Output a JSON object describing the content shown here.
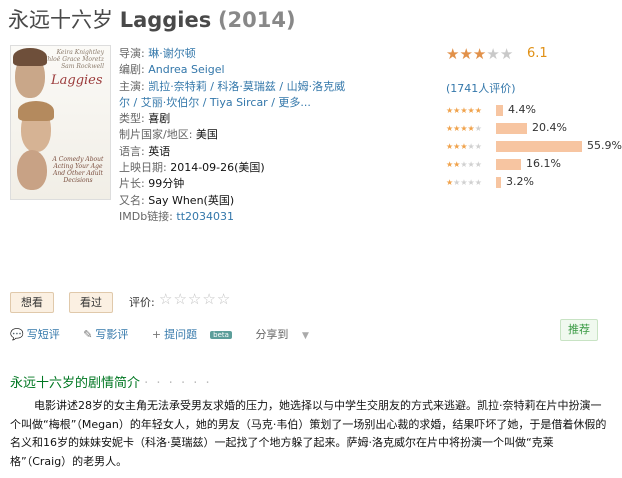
{
  "title": {
    "cn": "永远十六岁",
    "en": "Laggies",
    "year": "(2014)"
  },
  "poster": {
    "credits": [
      "Keira Knightley",
      "Chloë Grace Moretz",
      "Sam Rockwell"
    ],
    "title": "Laggies",
    "tagline": "A Comedy About Acting Your Age And Other Adult Decisions"
  },
  "info": {
    "director_label": "导演:",
    "director": "琳·谢尔顿",
    "writer_label": "编剧:",
    "writer": "Andrea Seigel",
    "cast_label": "主演:",
    "cast_line1": "凯拉·奈特莉 / 科洛·莫瑞兹 / 山姆·洛克威",
    "cast_line2": "尔 / 艾丽·坎伯尔 / Tiya Sircar / 更多...",
    "genre_label": "类型:",
    "genre": "喜剧",
    "country_label": "制片国家/地区:",
    "country": "美国",
    "language_label": "语言:",
    "language": "英语",
    "release_label": "上映日期:",
    "release": "2014-09-26(美国)",
    "runtime_label": "片长:",
    "runtime": "99分钟",
    "aka_label": "又名:",
    "aka": "Say When(英国)",
    "imdb_label": "IMDb链接:",
    "imdb": "tt2034031"
  },
  "rating": {
    "score": "6.1",
    "stars": 3,
    "count_text": "(1741人评价)",
    "distribution": [
      {
        "stars": 5,
        "percent": 4.4,
        "label": "4.4%"
      },
      {
        "stars": 4,
        "percent": 20.4,
        "label": "20.4%"
      },
      {
        "stars": 3,
        "percent": 55.9,
        "label": "55.9%"
      },
      {
        "stars": 2,
        "percent": 16.1,
        "label": "16.1%"
      },
      {
        "stars": 1,
        "percent": 3.2,
        "label": "3.2%"
      }
    ]
  },
  "buttons": {
    "want": "想看",
    "seen": "看过",
    "rate_label": "评价:"
  },
  "actions": {
    "short_review": "写短评",
    "review": "写影评",
    "ask": "提问题",
    "beta": "beta",
    "share": "分享到",
    "recommend": "推荐"
  },
  "summary": {
    "title": "永远十六岁的剧情简介",
    "dots": "· · · · · ·",
    "text": "电影讲述28岁的女主角无法承受男友求婚的压力，她选择以与中学生交朋友的方式来逃避。凯拉·奈特莉在片中扮演一个叫做“梅根”（Megan）的年轻女人，她的男友（马克·韦伯）策划了一场别出心裁的求婚，结果吓坏了她，于是借着休假的名义和16岁的妹妹安妮卡（科洛·莫瑞兹）一起找了个地方躲了起来。萨姆·洛克威尔在片中将扮演一个叫做“克莱格”（Craig）的老男人。"
  },
  "colors": {
    "link": "#3377aa",
    "star": "#e1914a",
    "bar": "#f7c5a1",
    "green_heading": "#007722"
  }
}
